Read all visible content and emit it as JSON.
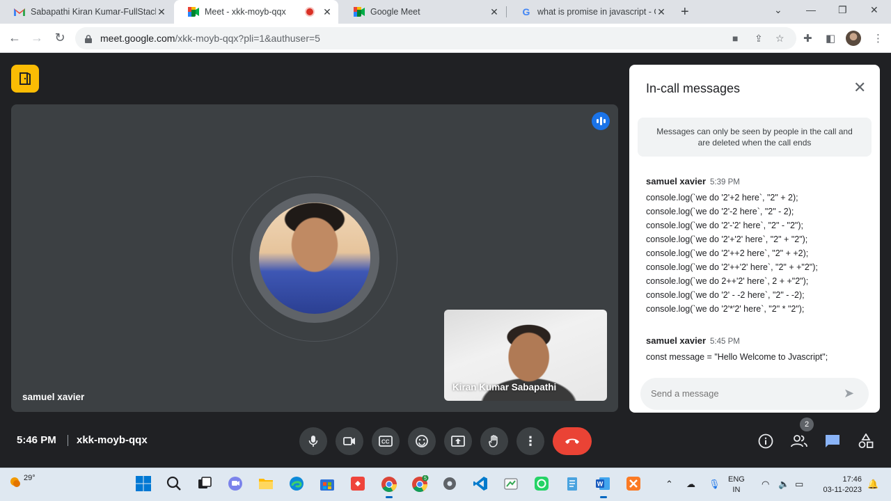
{
  "browser": {
    "tabs": [
      {
        "title": "Sabapathi Kiran Kumar-FullStack",
        "icon": "gmail-icon"
      },
      {
        "title": "Meet - xkk-moyb-qqx",
        "icon": "meet-icon",
        "recording": true
      },
      {
        "title": "Google Meet",
        "icon": "meet-icon"
      },
      {
        "title": "what is promise in javascript - G",
        "icon": "google-icon"
      }
    ],
    "url_host": "meet.google.com",
    "url_path": "/xkk-moyb-qqx?pli=1&authuser=5"
  },
  "meet": {
    "main_participant": "samuel xavier",
    "self_participant": "Kiran Kumar Sabapathi",
    "clock": "5:46 PM",
    "meeting_code": "xkk-moyb-qqx",
    "people_count": "2",
    "accent_color": "#1a73e8",
    "leave_color": "#ea4335"
  },
  "chat": {
    "title": "In-call messages",
    "notice": "Messages can only be seen by people in the call and are deleted when the call ends",
    "messages": [
      {
        "sender": "samuel xavier",
        "time": "5:39 PM",
        "lines": [
          "console.log(`we do '2'+2 here`, \"2\" + 2);",
          "console.log(`we do '2'-2 here`, \"2\" - 2);",
          "console.log(`we do '2'-'2' here`, \"2\" - \"2\");",
          "console.log(`we do '2'+'2' here`, \"2\" + \"2\");",
          "console.log(`we do '2'++2 here`, \"2\" + +2);",
          "console.log(`we do '2'++'2' here`, \"2\" + +\"2\");",
          "console.log(`we do 2++'2' here`, 2 + +\"2\");",
          "console.log(`we do '2' - -2 here`, \"2\" - -2);",
          "console.log(`we do '2'*'2' here`, \"2\" * \"2\");"
        ]
      },
      {
        "sender": "samuel xavier",
        "time": "5:45 PM",
        "lines": [
          "const message = \"Hello Welcome to Jvascript\";"
        ]
      }
    ],
    "input_placeholder": "Send a message"
  },
  "taskbar": {
    "weather_temp": "29°",
    "lang_top": "ENG",
    "lang_bottom": "IN",
    "time": "17:46",
    "date": "03-11-2023",
    "edge_badge": "5"
  }
}
